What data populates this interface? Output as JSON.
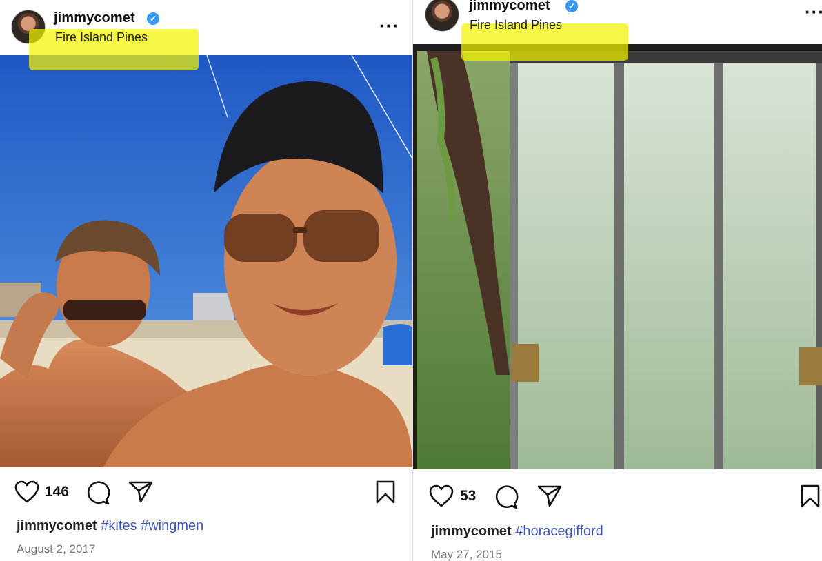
{
  "posts": [
    {
      "username": "jimmycomet",
      "location": "Fire Island Pines",
      "likes": "146",
      "caption_user": "jimmycomet",
      "caption_tags": [
        "#kites",
        "#wingmen"
      ],
      "date": "August 2, 2017"
    },
    {
      "username": "jimmycomet",
      "location": "Fire Island Pines",
      "likes": "53",
      "caption_user": "jimmycomet",
      "caption_tags": [
        "#horacegifford"
      ],
      "date": "May 27, 2015"
    }
  ],
  "icons": {
    "verified": "verified-badge-icon",
    "more": "more-options-icon",
    "like": "heart-icon",
    "comment": "comment-icon",
    "share": "paper-plane-icon",
    "save": "bookmark-icon"
  },
  "colors": {
    "highlight": "#f3f200",
    "hashtag": "#3b54b5",
    "verified": "#3897f0"
  }
}
